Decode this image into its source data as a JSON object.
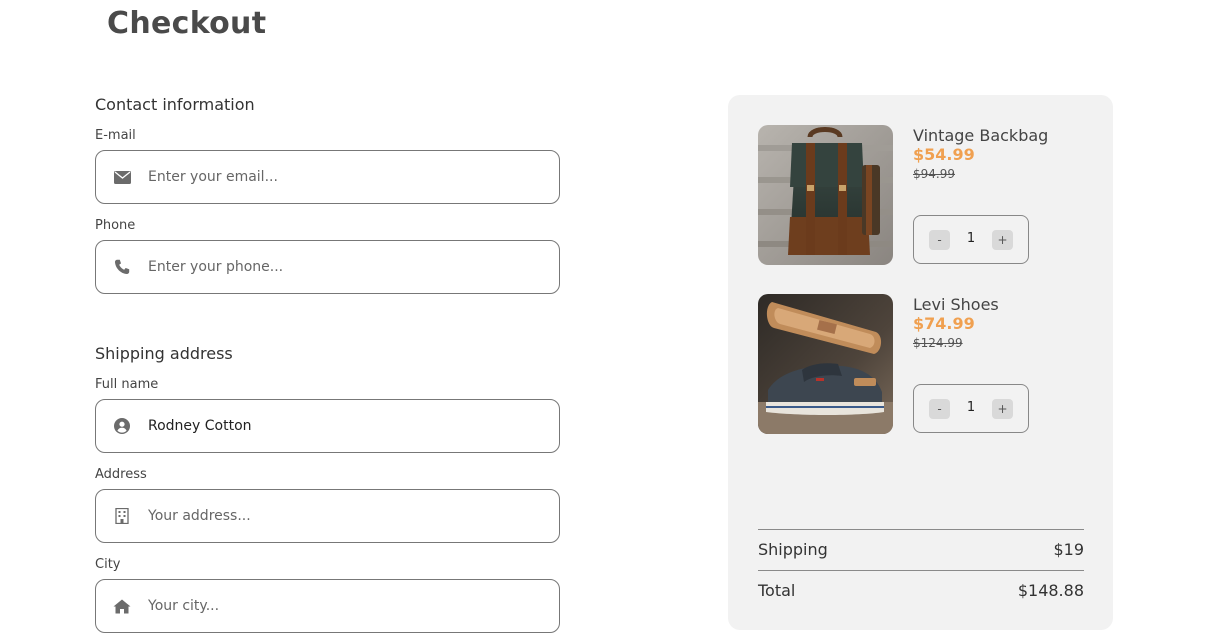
{
  "page": {
    "title": "Checkout"
  },
  "contact": {
    "section_title": "Contact information",
    "email": {
      "label": "E-mail",
      "placeholder": "Enter your email...",
      "value": "",
      "icon": "envelope-icon"
    },
    "phone": {
      "label": "Phone",
      "placeholder": "Enter your phone...",
      "value": "",
      "icon": "phone-icon"
    }
  },
  "shipping": {
    "section_title": "Shipping address",
    "full_name": {
      "label": "Full name",
      "placeholder": "",
      "value": "Rodney Cotton",
      "icon": "user-circle-icon"
    },
    "address": {
      "label": "Address",
      "placeholder": "Your address...",
      "value": "",
      "icon": "building-icon"
    },
    "city": {
      "label": "City",
      "placeholder": "Your city...",
      "value": "",
      "icon": "home-icon"
    }
  },
  "cart": {
    "items": [
      {
        "name": "Vintage Backbag",
        "price": "$54.99",
        "old_price": "$94.99",
        "quantity": "1",
        "minus_label": "-",
        "plus_label": "+",
        "image": "backpack-image"
      },
      {
        "name": "Levi Shoes",
        "price": "$74.99",
        "old_price": "$124.99",
        "quantity": "1",
        "minus_label": "-",
        "plus_label": "+",
        "image": "shoes-image"
      }
    ],
    "shipping_label": "Shipping",
    "shipping_value": "$19",
    "total_label": "Total",
    "total_value": "$148.88"
  },
  "colors": {
    "accent_price": "#f0a050",
    "summary_bg": "#f2f2f2",
    "border": "#777777"
  }
}
